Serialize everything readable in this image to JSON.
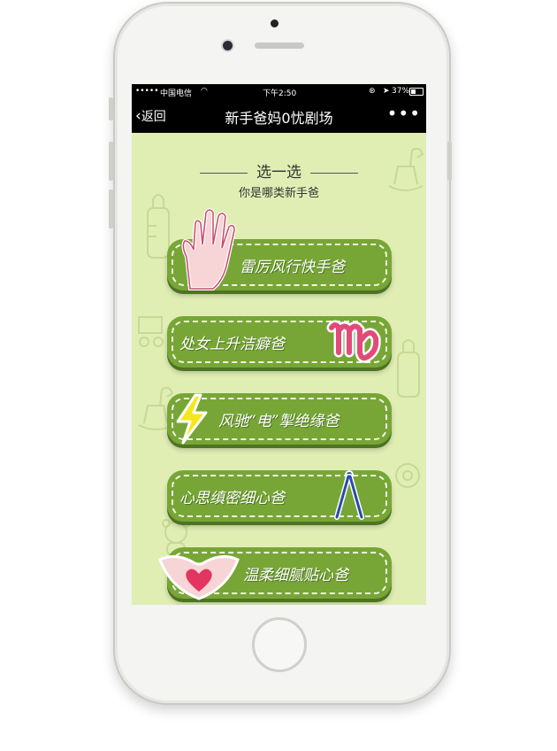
{
  "status": {
    "carrier": "中国电信",
    "time": "下午2:50",
    "battery": "37%"
  },
  "nav": {
    "back": "返回",
    "title": "新手爸妈0忧剧场",
    "more": "•••"
  },
  "heading": {
    "title": "选一选",
    "subtitle": "你是哪类新手爸"
  },
  "options": [
    {
      "label": "雷厉风行快手爸",
      "icon": "hand-icon"
    },
    {
      "label": "处女上升洁癖爸",
      "icon": "virgo-icon"
    },
    {
      "label": "风驰“电”掣绝缘爸",
      "icon": "lightning-icon"
    },
    {
      "label": "心思缜密细心爸",
      "icon": "compass-icon"
    },
    {
      "label": "温柔细腻贴心爸",
      "icon": "heart-hands-icon"
    }
  ],
  "colors": {
    "background": "#e0eeb4",
    "button": "#77a637",
    "accent_pink": "#e24a7a"
  }
}
